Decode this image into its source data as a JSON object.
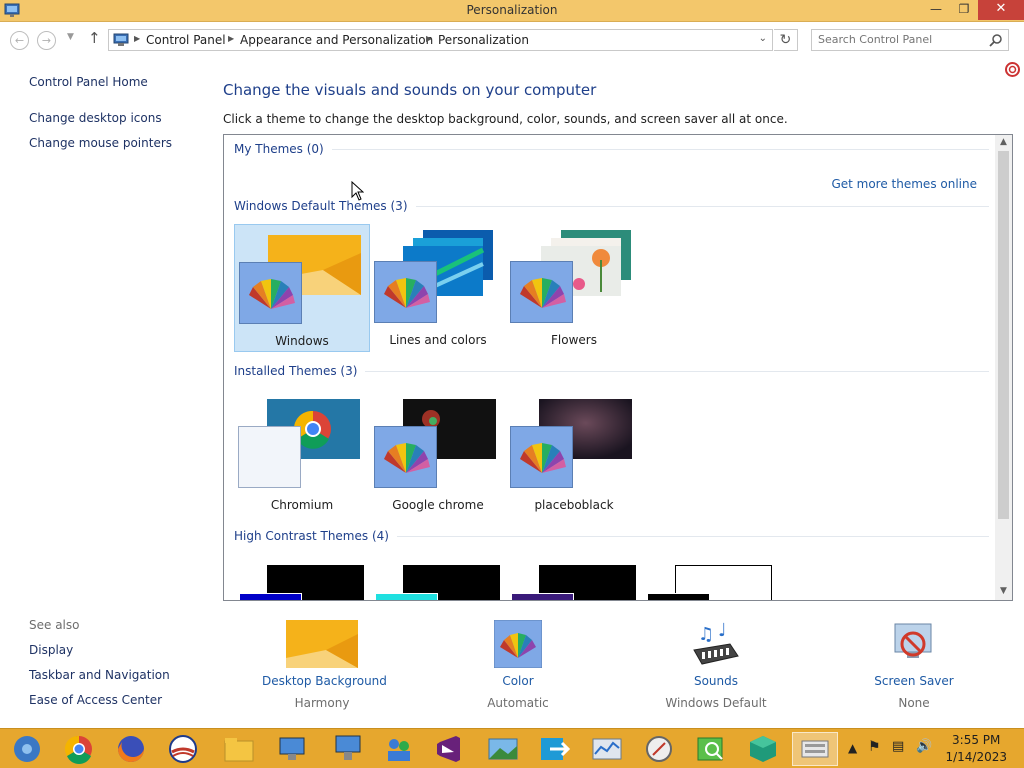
{
  "window": {
    "title": "Personalization",
    "minimize_glyph": "—",
    "maximize_glyph": "❐",
    "close_glyph": "✕"
  },
  "address_bar": {
    "crumbs": [
      "Control Panel",
      "Appearance and Personalization",
      "Personalization"
    ],
    "search_placeholder": "Search Control Panel"
  },
  "left_pane": {
    "links": [
      "Control Panel Home",
      "Change desktop icons",
      "Change mouse pointers"
    ],
    "see_also_label": "See also",
    "see_also_links": [
      "Display",
      "Taskbar and Navigation",
      "Ease of Access Center"
    ]
  },
  "main": {
    "heading": "Change the visuals and sounds on your computer",
    "subheading": "Click a theme to change the desktop background, color, sounds, and screen saver all at once.",
    "get_more_link": "Get more themes online",
    "groups": [
      {
        "title": "My Themes (0)",
        "themes": []
      },
      {
        "title": "Windows Default Themes (3)",
        "themes": [
          "Windows",
          "Lines and colors",
          "Flowers"
        ]
      },
      {
        "title": "Installed Themes (3)",
        "themes": [
          "Chromium",
          "Google chrome",
          "placeboblack"
        ]
      },
      {
        "title": "High Contrast Themes (4)",
        "themes": []
      }
    ],
    "selected_theme": "Windows"
  },
  "bottom_options": [
    {
      "label": "Desktop Background",
      "value": "Harmony",
      "icon": "desktop-background-icon"
    },
    {
      "label": "Color",
      "value": "Automatic",
      "icon": "color-fan-icon"
    },
    {
      "label": "Sounds",
      "value": "Windows Default",
      "icon": "sounds-icon"
    },
    {
      "label": "Screen Saver",
      "value": "None",
      "icon": "screen-saver-icon"
    }
  ],
  "taskbar": {
    "apps": [
      "chromium-icon",
      "chrome-icon",
      "firefox-icon",
      "obama-logo-icon",
      "file-explorer-icon",
      "network-remote-icon",
      "remote-desktop-icon",
      "people-icon",
      "visual-studio-icon",
      "photo-viewer-icon",
      "share-arrow-icon",
      "performance-monitor-icon",
      "compass-icon",
      "search-tool-icon",
      "green-cube-icon",
      "control-panel-icon"
    ],
    "clock_time": "3:55 PM",
    "clock_date": "1/14/2023"
  },
  "colors": {
    "titlebar": "#f3c76b",
    "taskbar": "#e6a72e",
    "link": "#1e5aa5",
    "heading": "#1e3f8a",
    "selected": "#cce4f7"
  }
}
